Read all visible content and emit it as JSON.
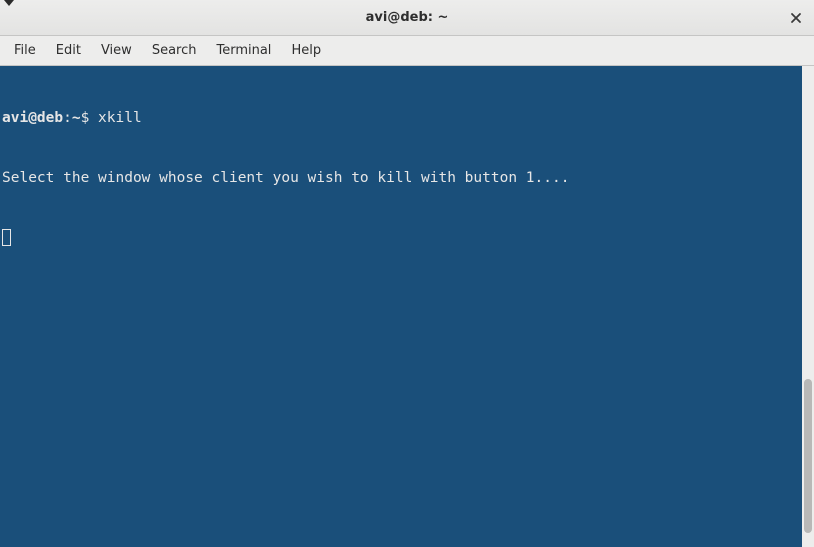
{
  "window": {
    "title": "avi@deb: ~"
  },
  "menu": {
    "items": [
      {
        "label": "File"
      },
      {
        "label": "Edit"
      },
      {
        "label": "View"
      },
      {
        "label": "Search"
      },
      {
        "label": "Terminal"
      },
      {
        "label": "Help"
      }
    ]
  },
  "terminal": {
    "prompt_userhost": "avi@deb",
    "prompt_sep": ":",
    "prompt_path": "~",
    "prompt_symbol": "$ ",
    "command": "xkill",
    "output_line1": "Select the window whose client you wish to kill with button 1...."
  },
  "colors": {
    "terminal_bg": "#1a4f7a",
    "terminal_fg": "#e6e6e6"
  }
}
